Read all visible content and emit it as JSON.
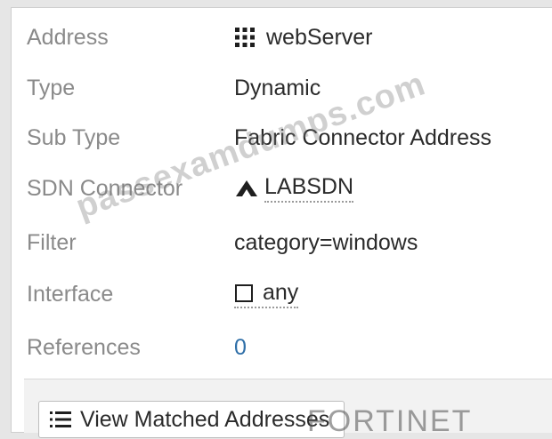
{
  "details": {
    "rows": [
      {
        "label": "Address",
        "value": "webServer",
        "icon": "grid-icon"
      },
      {
        "label": "Type",
        "value": "Dynamic"
      },
      {
        "label": "Sub Type",
        "value": "Fabric Connector Address"
      },
      {
        "label": "SDN Connector",
        "value": "LABSDN",
        "icon": "aws-connector-icon"
      },
      {
        "label": "Filter",
        "value": "category=windows"
      },
      {
        "label": "Interface",
        "value": "any",
        "icon": "interface-square-icon"
      },
      {
        "label": "References",
        "value": "0"
      }
    ]
  },
  "actions": {
    "view_matched_label": "View Matched Addresses"
  },
  "overlay": {
    "watermark": "passexamdumps.com",
    "brand": "FORTINET"
  },
  "colors": {
    "label": "#8a8a8a",
    "value": "#2b2b2b",
    "link": "#2f6fa8",
    "panel": "#ffffff"
  }
}
